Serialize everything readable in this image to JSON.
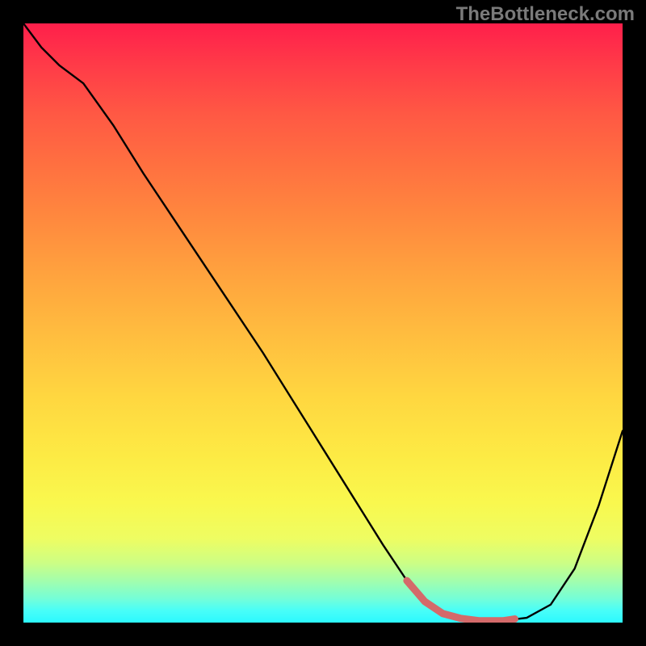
{
  "watermark": "TheBottleneck.com",
  "colors": {
    "curve": "#000000",
    "valley_marker": "#d46a6a",
    "frame": "#000000"
  },
  "chart_data": {
    "type": "line",
    "title": "",
    "xlabel": "",
    "ylabel": "",
    "xlim": [
      0,
      100
    ],
    "ylim": [
      0,
      100
    ],
    "series": [
      {
        "name": "bottleneck_curve",
        "x": [
          0,
          3,
          6,
          10,
          15,
          20,
          25,
          30,
          35,
          40,
          45,
          50,
          55,
          60,
          64,
          67,
          70,
          73,
          76,
          80,
          84,
          88,
          92,
          96,
          100
        ],
        "y": [
          100,
          96,
          93,
          90,
          83,
          75,
          67.5,
          60,
          52.5,
          45,
          37,
          29,
          21,
          13,
          7,
          3.5,
          1.5,
          0.7,
          0.3,
          0.3,
          0.8,
          3,
          9,
          19.5,
          32
        ]
      }
    ],
    "optimal_range": {
      "name": "valley_marker",
      "x": [
        64,
        67,
        70,
        73,
        76,
        80,
        82
      ],
      "y": [
        7,
        3.5,
        1.5,
        0.7,
        0.3,
        0.3,
        0.6
      ]
    },
    "annotations": []
  }
}
